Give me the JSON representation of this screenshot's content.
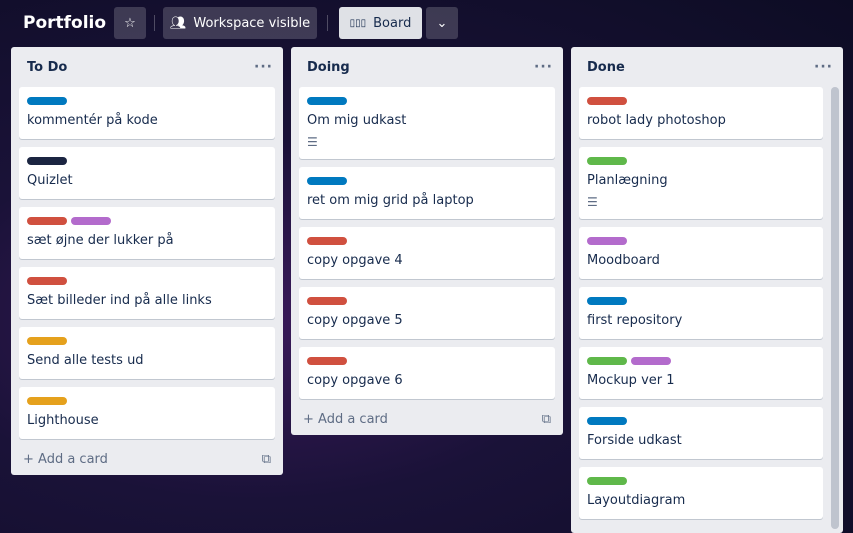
{
  "header": {
    "title": "Portfolio",
    "visibility_label": "Workspace visible",
    "view_label": "Board"
  },
  "add_card_label": "Add a card",
  "colors": {
    "blue": "#0079bf",
    "navy": "#1b2541",
    "red": "#d0503f",
    "purple": "#b36bcc",
    "orange": "#e5a11d",
    "green": "#5fb84a"
  },
  "lists": [
    {
      "name": "To Do",
      "cards": [
        {
          "title": "kommentér på kode",
          "labels": [
            "blue"
          ]
        },
        {
          "title": "Quizlet",
          "labels": [
            "navy"
          ]
        },
        {
          "title": "sæt øjne der lukker på",
          "labels": [
            "red",
            "purple"
          ]
        },
        {
          "title": "Sæt billeder ind på alle links",
          "labels": [
            "red"
          ]
        },
        {
          "title": "Send alle tests ud",
          "labels": [
            "orange"
          ]
        },
        {
          "title": "Lighthouse",
          "labels": [
            "orange"
          ]
        }
      ]
    },
    {
      "name": "Doing",
      "cards": [
        {
          "title": "Om mig udkast",
          "labels": [
            "blue"
          ],
          "description": true
        },
        {
          "title": "ret om mig grid på laptop",
          "labels": [
            "blue"
          ]
        },
        {
          "title": "copy opgave 4",
          "labels": [
            "red"
          ]
        },
        {
          "title": "copy opgave 5",
          "labels": [
            "red"
          ]
        },
        {
          "title": "copy opgave 6",
          "labels": [
            "red"
          ]
        }
      ]
    },
    {
      "name": "Done",
      "cards": [
        {
          "title": "robot lady photoshop",
          "labels": [
            "red"
          ]
        },
        {
          "title": "Planlægning",
          "labels": [
            "green"
          ],
          "description": true
        },
        {
          "title": "Moodboard",
          "labels": [
            "purple"
          ]
        },
        {
          "title": "first repository",
          "labels": [
            "blue"
          ]
        },
        {
          "title": "Mockup ver 1",
          "labels": [
            "green",
            "purple"
          ]
        },
        {
          "title": "Forside udkast",
          "labels": [
            "blue"
          ]
        },
        {
          "title": "Layoutdiagram",
          "labels": [
            "green"
          ]
        }
      ]
    }
  ]
}
